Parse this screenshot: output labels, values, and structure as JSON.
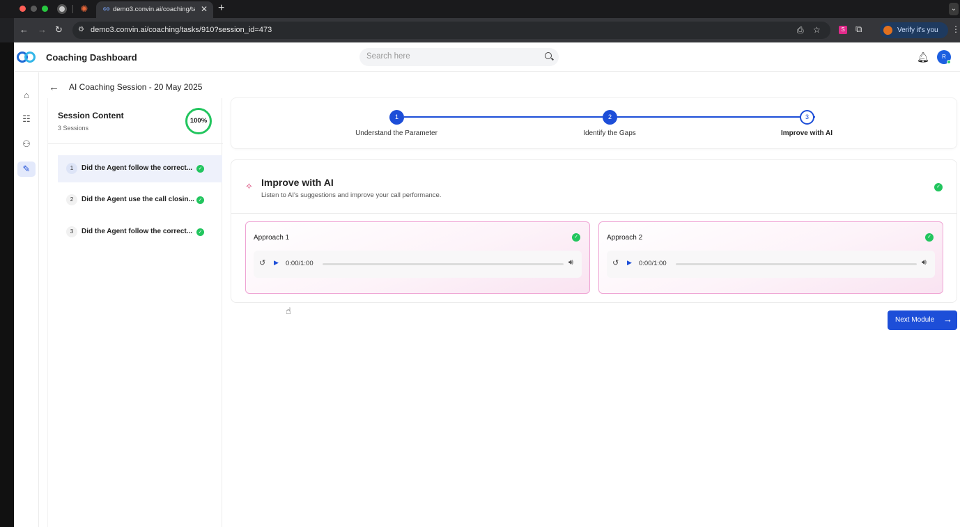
{
  "browser": {
    "tab_title": "demo3.convin.ai/coaching/tasks/910?session_id=473",
    "url": "demo3.convin.ai/coaching/tasks/910?session_id=473",
    "verify_label": "Verify it's you",
    "ext_badge": "S"
  },
  "header": {
    "app_title": "Coaching Dashboard",
    "search_placeholder": "Search here",
    "avatar_initial": "R"
  },
  "page": {
    "title": "AI Coaching Session - 20 May 2025"
  },
  "session_content": {
    "title": "Session Content",
    "subtitle": "3 Sessions",
    "progress": "100%",
    "sessions": [
      {
        "num": "1",
        "label": "Did the Agent follow the correct..."
      },
      {
        "num": "2",
        "label": "Did the Agent use the call closin..."
      },
      {
        "num": "3",
        "label": "Did the Agent follow the correct..."
      }
    ]
  },
  "stepper": {
    "steps": [
      {
        "num": "1",
        "label": "Understand the Parameter"
      },
      {
        "num": "2",
        "label": "Identify the Gaps"
      },
      {
        "num": "3",
        "label": "Improve with AI"
      }
    ]
  },
  "improve": {
    "title": "Improve with AI",
    "subtitle": "Listen to AI's suggestions and improve your call performance.",
    "approaches": [
      {
        "title": "Approach 1",
        "time": "0:00/1:00"
      },
      {
        "title": "Approach 2",
        "time": "0:00/1:00"
      }
    ]
  },
  "next_button": {
    "label": "Next Module"
  },
  "colors": {
    "accent": "#1d4ed8",
    "success": "#22c55e",
    "approach_border": "#efa4d4"
  }
}
